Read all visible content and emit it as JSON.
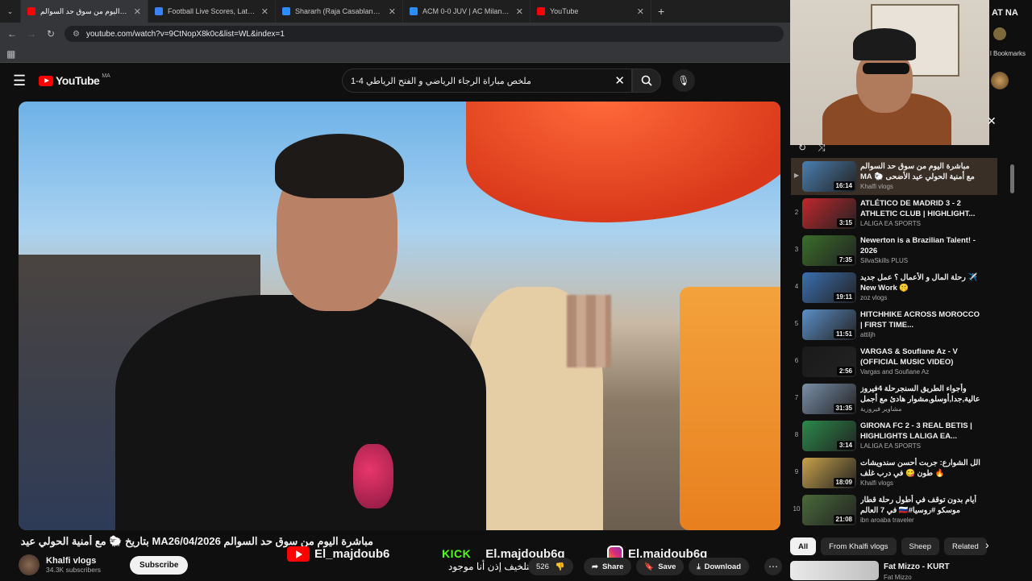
{
  "browser": {
    "tabs": [
      {
        "title": "مباشرة اليوم من سوق حد السوالم",
        "active": true,
        "color": "#ff0000"
      },
      {
        "title": "Football Live Scores, Latest Foo",
        "active": false,
        "color": "#3b82f6"
      },
      {
        "title": "Shararh (Raja Casablanca) Stats",
        "active": false,
        "color": "#2d8cff"
      },
      {
        "title": "ACM 0-0 JUV | AC Milan v Juve",
        "active": false,
        "color": "#2d8cff"
      },
      {
        "title": "YouTube",
        "active": false,
        "color": "#ff0000"
      }
    ],
    "new_tab": "+",
    "url": "youtube.com/watch?v=9CtNopX8k0c&list=WL&index=1",
    "bookmarks_label": "l Bookmarks",
    "right_label": "AT NA"
  },
  "youtube": {
    "logo_text": "YouTube",
    "logo_region": "MA",
    "search_query": "ملخص مباراة الرجاء الرياضي و الفتح الرياطي 4-1"
  },
  "video": {
    "title": "مباشرة اليوم من سوق حد السوالم MA26/04/2026 بتاريخ 🐑 مع أمنية الحولي عيد الأضحى",
    "overlay_handle_yt": "El_majdoub6",
    "overlay_kick_label": "KICK",
    "overlay_handle_kick": "El.majdoub6g",
    "overlay_handle_ig": "El.majdoub6g",
    "overlay_arabic": "نتلخيف إذن أنا موجود",
    "channel_name": "Khalfi vlogs",
    "subscribers": "34.3K subscribers",
    "subscribe_label": "Subscribe",
    "likes": "526",
    "share_label": "Share",
    "save_label": "Save",
    "download_label": "Download"
  },
  "playlist": {
    "items": [
      {
        "index": "▶",
        "title": "مباشرة اليوم من سوق حد السوالم MA مع أمنية الحولي عيد الأضحى 🐑 بتاريخ",
        "channel": "Khalfi vlogs",
        "duration": "16:14",
        "active": true,
        "thumb": "#4a7fb0"
      },
      {
        "index": "2",
        "title": "ATLÉTICO DE MADRID 3 - 2 ATHLETIC CLUB | HIGHLIGHT...",
        "channel": "LALIGA EA SPORTS",
        "duration": "3:15",
        "active": false,
        "thumb": "#c1272d"
      },
      {
        "index": "3",
        "title": "Newerton is a Brazilian Talent! - 2026",
        "channel": "SilvaSkills PLUS",
        "duration": "7:35",
        "active": false,
        "thumb": "#3a6e2a"
      },
      {
        "index": "4",
        "title": "رحلة المال و الأعمال ؟ عمل جديد ✈️ New Work 🤫",
        "channel": "zoz vlogs",
        "duration": "19:11",
        "active": false,
        "thumb": "#3b6fb0"
      },
      {
        "index": "5",
        "title": "HITCHHIKE ACROSS MOROCCO | FIRST TIME...",
        "channel": "attiljh",
        "duration": "11:51",
        "active": false,
        "thumb": "#5b8fc7"
      },
      {
        "index": "6",
        "title": "VARGAS & Soufiane Az - V (OFFICIAL MUSIC VIDEO)",
        "channel": "Vargas and Soufiane Az",
        "duration": "2:56",
        "active": false,
        "thumb": "#1a1a1a"
      },
      {
        "index": "7",
        "title": "وأجواء الطريق السنجرحلة 4فيروز عالية,جدا,أوسلو,مشوار هادئ مع أجمل",
        "channel": "مشاوير فيروزية",
        "duration": "31:35",
        "active": false,
        "thumb": "#7a8fa8"
      },
      {
        "index": "8",
        "title": "GIRONA FC 2 - 3 REAL BETIS | HIGHLIGHTS LALIGA EA...",
        "channel": "LALIGA EA SPORTS",
        "duration": "3:14",
        "active": false,
        "thumb": "#2a8a4a"
      },
      {
        "index": "9",
        "title": "الل الشوارع: جربت أحسن سندويشات طون 😋 في درب غلف 🔥",
        "channel": "Khalfi vlogs",
        "duration": "18:09",
        "active": false,
        "thumb": "#c9a24a"
      },
      {
        "index": "10",
        "title": "أيام بدون توقف في أطول رحلة قطار في 7 العالم 🇷🇺#موسكو #روسيا #moscow...",
        "channel": "ibn aroaba traveler",
        "duration": "21:08",
        "active": false,
        "thumb": "#4a6a3a"
      }
    ]
  },
  "chips": [
    "All",
    "From Khalfi vlogs",
    "Sheep",
    "Related"
  ],
  "next_video": {
    "title": "Fat Mizzo - KURT",
    "channel": "Fat Mizzo"
  }
}
